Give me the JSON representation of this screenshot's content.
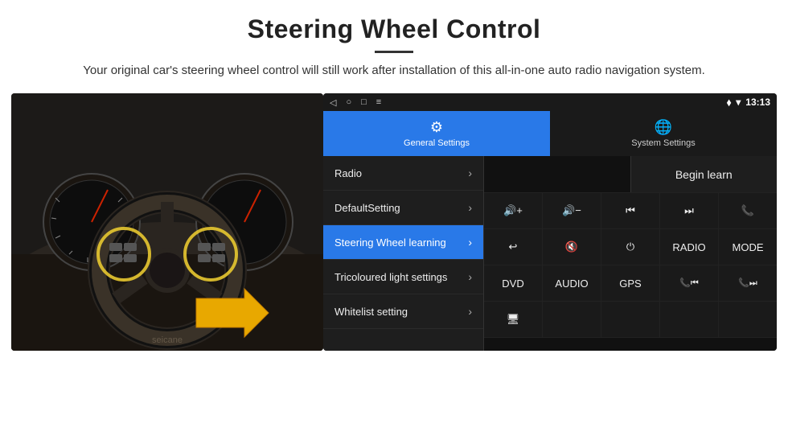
{
  "header": {
    "title": "Steering Wheel Control",
    "subtitle": "Your original car's steering wheel control will still work after installation of this all-in-one auto radio navigation system."
  },
  "status_bar": {
    "icons_left": [
      "◁",
      "○",
      "□",
      "≡"
    ],
    "time": "13:13"
  },
  "tabs": [
    {
      "id": "general",
      "label": "General Settings",
      "active": true
    },
    {
      "id": "system",
      "label": "System Settings",
      "active": false
    }
  ],
  "menu_items": [
    {
      "label": "Radio",
      "active": false,
      "has_chevron": true
    },
    {
      "label": "DefaultSetting",
      "active": false,
      "has_chevron": true
    },
    {
      "label": "Steering Wheel learning",
      "active": true,
      "has_chevron": true
    },
    {
      "label": "Tricoloured light settings",
      "active": false,
      "has_chevron": true
    },
    {
      "label": "Whitelist setting",
      "active": false,
      "has_chevron": true
    }
  ],
  "right_panel": {
    "begin_learn_label": "Begin learn",
    "control_rows": [
      [
        {
          "label": "🔊+",
          "type": "vol-up"
        },
        {
          "label": "🔊−",
          "type": "vol-down"
        },
        {
          "label": "⏮",
          "type": "prev"
        },
        {
          "label": "⏭",
          "type": "next"
        },
        {
          "label": "📞",
          "type": "call"
        }
      ],
      [
        {
          "label": "↩",
          "type": "back"
        },
        {
          "label": "🔇",
          "type": "mute"
        },
        {
          "label": "⏻",
          "type": "power"
        },
        {
          "label": "RADIO",
          "type": "radio"
        },
        {
          "label": "MODE",
          "type": "mode"
        }
      ],
      [
        {
          "label": "DVD",
          "type": "dvd"
        },
        {
          "label": "AUDIO",
          "type": "audio"
        },
        {
          "label": "GPS",
          "type": "gps"
        },
        {
          "label": "📞⏮",
          "type": "tel-prev"
        },
        {
          "label": "📞⏭",
          "type": "tel-next"
        }
      ],
      [
        {
          "label": "🖥",
          "type": "display"
        }
      ]
    ]
  }
}
